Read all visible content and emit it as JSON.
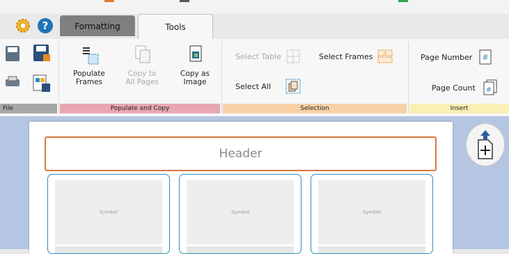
{
  "tabs": {
    "formatting": "Formatting",
    "tools": "Tools"
  },
  "ribbon": {
    "file_group": "File",
    "populate_group": {
      "label": "Populate and Copy",
      "populate_frames": "Populate\nFrames",
      "copy_to_all_pages": "Copy to\nAll Pages",
      "copy_as_image": "Copy as\nImage"
    },
    "selection_group": {
      "label": "Selection",
      "select_table": "Select Table",
      "select_frames": "Select Frames",
      "select_all": "Select All"
    },
    "insert_group": {
      "label": "Insert",
      "page_number": "Page Number",
      "page_count": "Page Count"
    }
  },
  "page": {
    "header": "Header",
    "frames": [
      {
        "symbol": "Symbol"
      },
      {
        "symbol": "Symbol"
      },
      {
        "symbol": "Symbol"
      }
    ]
  },
  "colors": {
    "populate_group": "#e8a7b2",
    "selection_group": "#f8d2a6",
    "insert_group": "#faf0b4",
    "file_group": "#a7a7a7",
    "header_border": "#d9793f",
    "frame_border": "#2c8fbf",
    "canvas": "#b5c6e2"
  },
  "icons": [
    "settings-gear-icon",
    "help-icon",
    "save-icon",
    "save-as-icon",
    "print-icon",
    "export-icon",
    "populate-frames-icon",
    "copy-to-all-pages-icon",
    "copy-as-image-icon",
    "select-table-icon",
    "select-frames-icon",
    "select-all-icon",
    "page-number-icon",
    "page-count-icon",
    "add-page-icon"
  ]
}
